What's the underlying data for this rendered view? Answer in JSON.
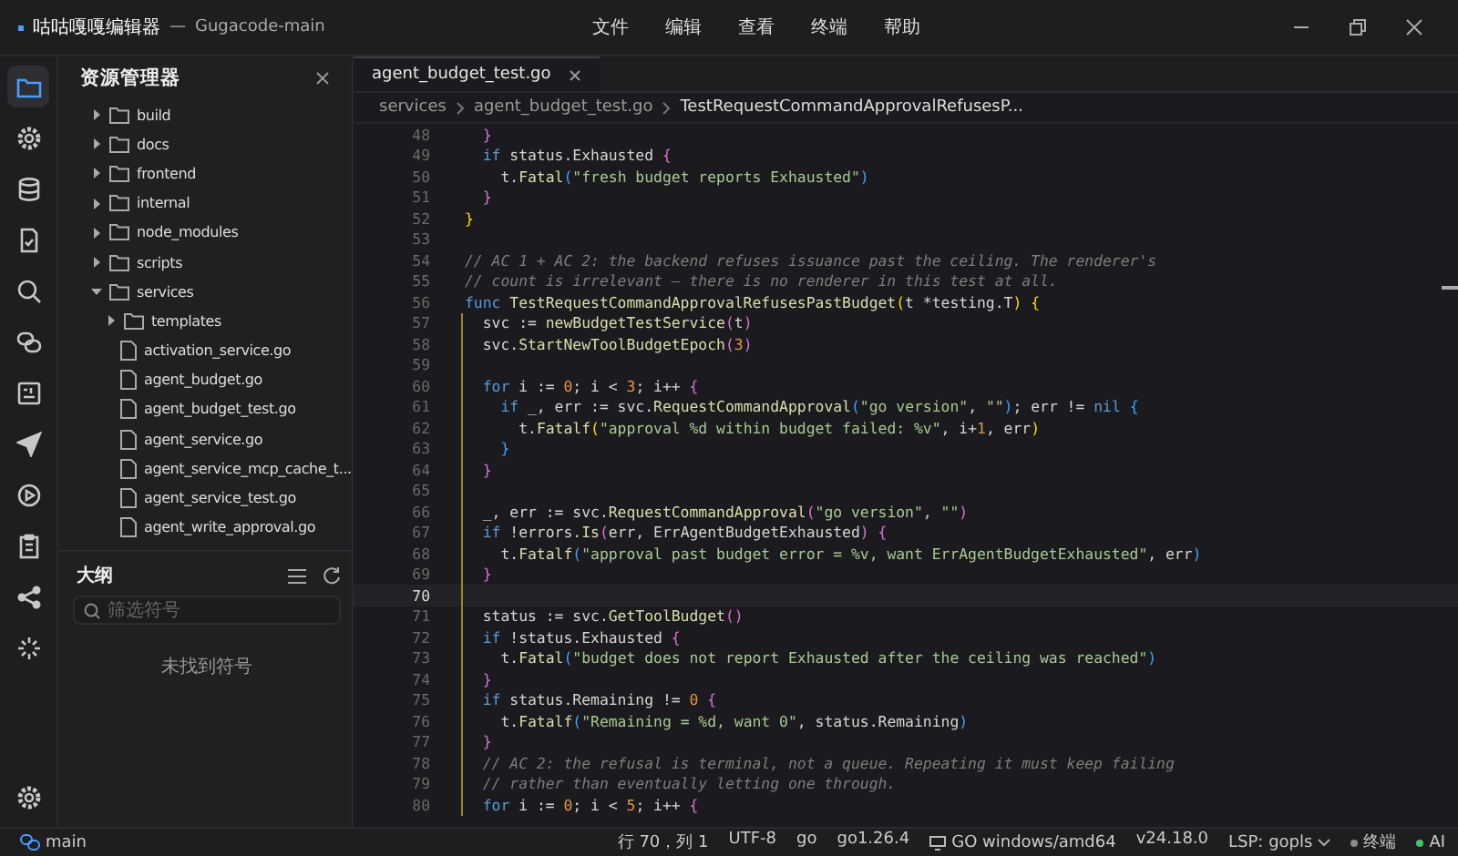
{
  "window": {
    "app_name": "咕咕嘎嘎编辑器",
    "separator": "—",
    "project": "Gugacode-main"
  },
  "menu": [
    "文件",
    "编辑",
    "查看",
    "终端",
    "帮助"
  ],
  "activity_bar": [
    {
      "selected": true
    },
    {
      "selected": false
    },
    {
      "selected": false
    },
    {
      "selected": false
    },
    {
      "selected": false
    },
    {
      "selected": false
    },
    {
      "selected": false
    },
    {
      "selected": false
    },
    {
      "selected": false
    },
    {
      "selected": false
    },
    {
      "selected": false
    },
    {
      "selected": false
    }
  ],
  "explorer": {
    "title": "资源管理器",
    "tree": [
      {
        "kind": "folder",
        "name": "build",
        "expanded": false
      },
      {
        "kind": "folder",
        "name": "docs",
        "expanded": false
      },
      {
        "kind": "folder",
        "name": "frontend",
        "expanded": false
      },
      {
        "kind": "folder",
        "name": "internal",
        "expanded": false
      },
      {
        "kind": "folder",
        "name": "node_modules",
        "expanded": false
      },
      {
        "kind": "folder",
        "name": "scripts",
        "expanded": false
      },
      {
        "kind": "folder",
        "name": "services",
        "expanded": true,
        "children": [
          {
            "kind": "folder",
            "name": "templates",
            "expanded": false
          },
          {
            "kind": "file",
            "name": "activation_service.go"
          },
          {
            "kind": "file",
            "name": "agent_budget.go"
          },
          {
            "kind": "file",
            "name": "agent_budget_test.go"
          },
          {
            "kind": "file",
            "name": "agent_service.go"
          },
          {
            "kind": "file",
            "name": "agent_service_mcp_cache_t..."
          },
          {
            "kind": "file",
            "name": "agent_service_test.go"
          },
          {
            "kind": "file",
            "name": "agent_write_approval.go"
          }
        ]
      }
    ]
  },
  "outline": {
    "title": "大纲",
    "filter": {
      "placeholder": "筛选符号"
    },
    "empty_text": "未找到符号"
  },
  "tabs": [
    {
      "label": "agent_budget_test.go",
      "selected": true
    }
  ],
  "breadcrumb": [
    "services",
    "agent_budget_test.go",
    "TestRequestCommandApprovalRefusesP..."
  ],
  "code": [
    {
      "number": "48",
      "current": false,
      "in_scope": false,
      "tokens": [
        {
          "kind": "b2",
          "text": "  }"
        }
      ]
    },
    {
      "number": "49",
      "current": false,
      "in_scope": false,
      "tokens": [
        {
          "kind": "kw",
          "text": "  if"
        },
        {
          "kind": "t",
          "text": " status.Exhausted "
        },
        {
          "kind": "b2",
          "text": "{"
        }
      ]
    },
    {
      "number": "50",
      "current": false,
      "in_scope": false,
      "tokens": [
        {
          "kind": "t",
          "text": "    t."
        },
        {
          "kind": "fn",
          "text": "Fatal"
        },
        {
          "kind": "b3",
          "text": "("
        },
        {
          "kind": "str",
          "text": "\"fresh budget reports Exhausted\""
        },
        {
          "kind": "b3",
          "text": ")"
        }
      ]
    },
    {
      "number": "51",
      "current": false,
      "in_scope": false,
      "tokens": [
        {
          "kind": "b2",
          "text": "  }"
        }
      ]
    },
    {
      "number": "52",
      "current": false,
      "in_scope": false,
      "tokens": [
        {
          "kind": "b1",
          "text": "}"
        }
      ]
    },
    {
      "number": "53",
      "current": false,
      "in_scope": false
    },
    {
      "number": "54",
      "current": false,
      "in_scope": false,
      "tokens": [
        {
          "kind": "com",
          "text": "// AC 1 + AC 2: the backend refuses issuance past the ceiling. The renderer's"
        }
      ]
    },
    {
      "number": "55",
      "current": false,
      "in_scope": false,
      "tokens": [
        {
          "kind": "com",
          "text": "// count is irrelevant — there is no renderer in this test at all."
        }
      ]
    },
    {
      "number": "56",
      "current": false,
      "in_scope": false,
      "tokens": [
        {
          "kind": "kw",
          "text": "func"
        },
        {
          "kind": "fn",
          "text": " TestRequestCommandApprovalRefusesPastBudget"
        },
        {
          "kind": "b1",
          "text": "("
        },
        {
          "kind": "t",
          "text": "t *testing.T"
        },
        {
          "kind": "b1",
          "text": ")"
        },
        {
          "kind": "b1",
          "text": " {"
        }
      ]
    },
    {
      "number": "57",
      "current": false,
      "in_scope": true,
      "tokens": [
        {
          "kind": "t",
          "text": "  svc := "
        },
        {
          "kind": "fn",
          "text": "newBudgetTestService"
        },
        {
          "kind": "b2",
          "text": "("
        },
        {
          "kind": "t",
          "text": "t"
        },
        {
          "kind": "b2",
          "text": ")"
        }
      ]
    },
    {
      "number": "58",
      "current": false,
      "in_scope": true,
      "tokens": [
        {
          "kind": "t",
          "text": "  svc."
        },
        {
          "kind": "fn",
          "text": "StartNewToolBudgetEpoch"
        },
        {
          "kind": "b2",
          "text": "("
        },
        {
          "kind": "num",
          "text": "3"
        },
        {
          "kind": "b2",
          "text": ")"
        }
      ]
    },
    {
      "number": "59",
      "current": false,
      "in_scope": true
    },
    {
      "number": "60",
      "current": false,
      "in_scope": true,
      "tokens": [
        {
          "kind": "kw",
          "text": "  for"
        },
        {
          "kind": "t",
          "text": " i := "
        },
        {
          "kind": "num",
          "text": "0"
        },
        {
          "kind": "t",
          "text": "; i < "
        },
        {
          "kind": "num",
          "text": "3"
        },
        {
          "kind": "t",
          "text": "; i++ "
        },
        {
          "kind": "b2",
          "text": "{"
        }
      ]
    },
    {
      "number": "61",
      "current": false,
      "in_scope": true,
      "tokens": [
        {
          "kind": "kw",
          "text": "    if"
        },
        {
          "kind": "t",
          "text": " _, err := svc."
        },
        {
          "kind": "fn",
          "text": "RequestCommandApproval"
        },
        {
          "kind": "b3",
          "text": "("
        },
        {
          "kind": "str",
          "text": "\"go version\""
        },
        {
          "kind": "t",
          "text": ", "
        },
        {
          "kind": "str",
          "text": "\"\""
        },
        {
          "kind": "b3",
          "text": ")"
        },
        {
          "kind": "t",
          "text": "; err != "
        },
        {
          "kind": "kw",
          "text": "nil"
        },
        {
          "kind": "b3",
          "text": " {"
        }
      ]
    },
    {
      "number": "62",
      "current": false,
      "in_scope": true,
      "tokens": [
        {
          "kind": "t",
          "text": "      t."
        },
        {
          "kind": "fn",
          "text": "Fatalf"
        },
        {
          "kind": "b1",
          "text": "("
        },
        {
          "kind": "str",
          "text": "\"approval %d within budget failed: %v\""
        },
        {
          "kind": "t",
          "text": ", i+"
        },
        {
          "kind": "num",
          "text": "1"
        },
        {
          "kind": "t",
          "text": ", err"
        },
        {
          "kind": "b1",
          "text": ")"
        }
      ]
    },
    {
      "number": "63",
      "current": false,
      "in_scope": true,
      "tokens": [
        {
          "kind": "b3",
          "text": "    }"
        }
      ]
    },
    {
      "number": "64",
      "current": false,
      "in_scope": true,
      "tokens": [
        {
          "kind": "b2",
          "text": "  }"
        }
      ]
    },
    {
      "number": "65",
      "current": false,
      "in_scope": true
    },
    {
      "number": "66",
      "current": false,
      "in_scope": true,
      "tokens": [
        {
          "kind": "t",
          "text": "  _, err := svc."
        },
        {
          "kind": "fn",
          "text": "RequestCommandApproval"
        },
        {
          "kind": "b2",
          "text": "("
        },
        {
          "kind": "str",
          "text": "\"go version\""
        },
        {
          "kind": "t",
          "text": ", "
        },
        {
          "kind": "str",
          "text": "\"\""
        },
        {
          "kind": "b2",
          "text": ")"
        }
      ]
    },
    {
      "number": "67",
      "current": false,
      "in_scope": true,
      "tokens": [
        {
          "kind": "kw",
          "text": "  if"
        },
        {
          "kind": "t",
          "text": " !errors."
        },
        {
          "kind": "fn",
          "text": "Is"
        },
        {
          "kind": "b2",
          "text": "("
        },
        {
          "kind": "t",
          "text": "err, ErrAgentBudgetExhausted"
        },
        {
          "kind": "b2",
          "text": ")"
        },
        {
          "kind": "b2",
          "text": " {"
        }
      ]
    },
    {
      "number": "68",
      "current": false,
      "in_scope": true,
      "tokens": [
        {
          "kind": "t",
          "text": "    t."
        },
        {
          "kind": "fn",
          "text": "Fatalf"
        },
        {
          "kind": "b3",
          "text": "("
        },
        {
          "kind": "str",
          "text": "\"approval past budget error = %v, want ErrAgentBudgetExhausted\""
        },
        {
          "kind": "t",
          "text": ", err"
        },
        {
          "kind": "b3",
          "text": ")"
        }
      ]
    },
    {
      "number": "69",
      "current": false,
      "in_scope": true,
      "tokens": [
        {
          "kind": "b2",
          "text": "  }"
        }
      ]
    },
    {
      "number": "70",
      "current": true,
      "in_scope": true
    },
    {
      "number": "71",
      "current": false,
      "in_scope": true,
      "tokens": [
        {
          "kind": "t",
          "text": "  status := svc."
        },
        {
          "kind": "fn",
          "text": "GetToolBudget"
        },
        {
          "kind": "b2",
          "text": "()"
        }
      ]
    },
    {
      "number": "72",
      "current": false,
      "in_scope": true,
      "tokens": [
        {
          "kind": "kw",
          "text": "  if"
        },
        {
          "kind": "t",
          "text": " !status.Exhausted "
        },
        {
          "kind": "b2",
          "text": "{"
        }
      ]
    },
    {
      "number": "73",
      "current": false,
      "in_scope": true,
      "tokens": [
        {
          "kind": "t",
          "text": "    t."
        },
        {
          "kind": "fn",
          "text": "Fatal"
        },
        {
          "kind": "b3",
          "text": "("
        },
        {
          "kind": "str",
          "text": "\"budget does not report Exhausted after the ceiling was reached\""
        },
        {
          "kind": "b3",
          "text": ")"
        }
      ]
    },
    {
      "number": "74",
      "current": false,
      "in_scope": true,
      "tokens": [
        {
          "kind": "b2",
          "text": "  }"
        }
      ]
    },
    {
      "number": "75",
      "current": false,
      "in_scope": true,
      "tokens": [
        {
          "kind": "kw",
          "text": "  if"
        },
        {
          "kind": "t",
          "text": " status.Remaining != "
        },
        {
          "kind": "num",
          "text": "0"
        },
        {
          "kind": "b2",
          "text": " {"
        }
      ]
    },
    {
      "number": "76",
      "current": false,
      "in_scope": true,
      "tokens": [
        {
          "kind": "t",
          "text": "    t."
        },
        {
          "kind": "fn",
          "text": "Fatalf"
        },
        {
          "kind": "b3",
          "text": "("
        },
        {
          "kind": "str",
          "text": "\"Remaining = %d, want 0\""
        },
        {
          "kind": "t",
          "text": ", status.Remaining"
        },
        {
          "kind": "b3",
          "text": ")"
        }
      ]
    },
    {
      "number": "77",
      "current": false,
      "in_scope": true,
      "tokens": [
        {
          "kind": "b2",
          "text": "  }"
        }
      ]
    },
    {
      "number": "78",
      "current": false,
      "in_scope": true,
      "tokens": [
        {
          "kind": "com",
          "text": "  // AC 2: the refusal is terminal, not a queue. Repeating it must keep failing"
        }
      ]
    },
    {
      "number": "79",
      "current": false,
      "in_scope": true,
      "tokens": [
        {
          "kind": "com",
          "text": "  // rather than eventually letting one through."
        }
      ]
    },
    {
      "number": "80",
      "current": false,
      "in_scope": true,
      "tokens": [
        {
          "kind": "kw",
          "text": "  for"
        },
        {
          "kind": "t",
          "text": " i := "
        },
        {
          "kind": "num",
          "text": "0"
        },
        {
          "kind": "t",
          "text": "; i < "
        },
        {
          "kind": "num",
          "text": "5"
        },
        {
          "kind": "t",
          "text": "; i++ "
        },
        {
          "kind": "b2",
          "text": "{"
        }
      ]
    }
  ],
  "status_bar": {
    "branch": "main",
    "items": [
      {
        "kind": "text",
        "label": "行 70，列 1"
      },
      {
        "kind": "text",
        "label": "UTF-8"
      },
      {
        "kind": "text",
        "label": "go"
      },
      {
        "kind": "text",
        "label": "go1.26.4"
      },
      {
        "kind": "monitor",
        "label": "GO windows/amd64"
      },
      {
        "kind": "text",
        "label": "v24.18.0"
      },
      {
        "kind": "dropdown",
        "label": "LSP: gopls"
      },
      {
        "kind": "dot",
        "label": "终端",
        "color": "#8a8a8a"
      },
      {
        "kind": "dot",
        "label": "AI",
        "color": "#3fc46a"
      }
    ]
  }
}
